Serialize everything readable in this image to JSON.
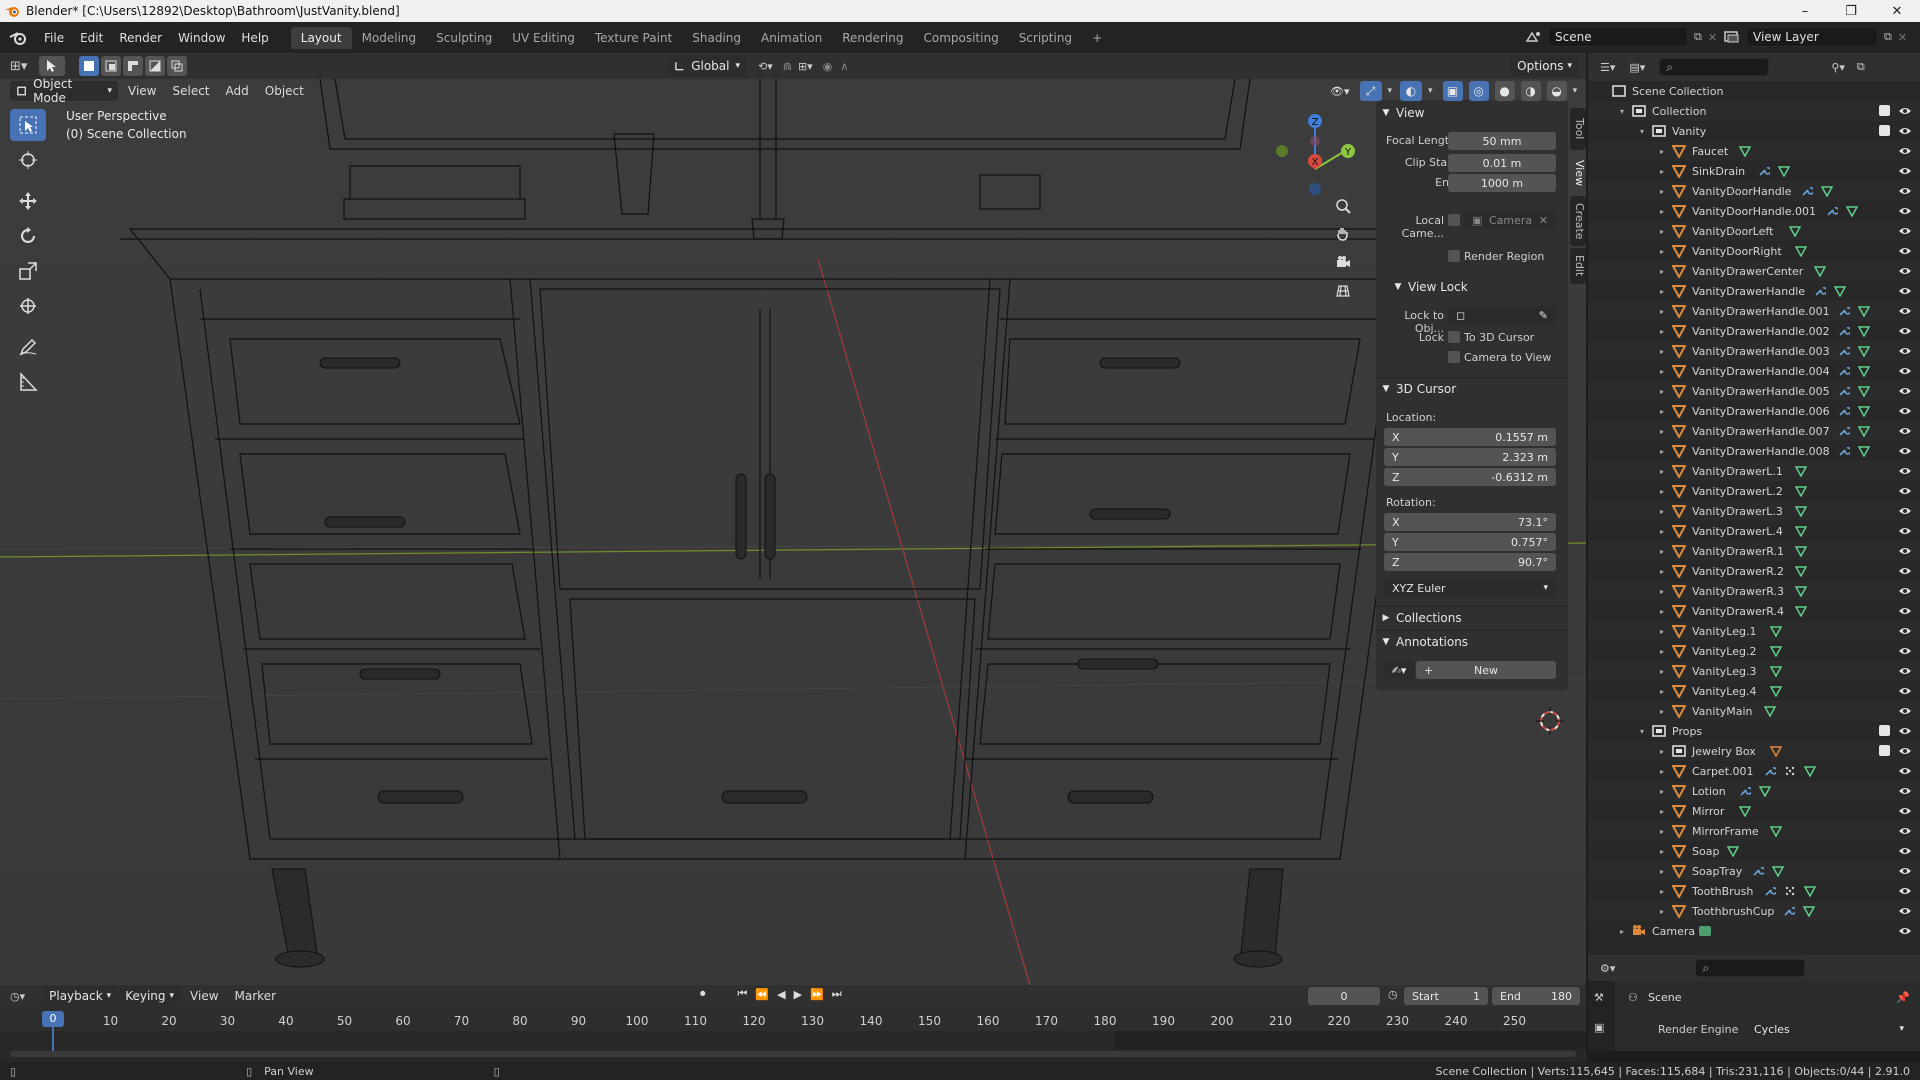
{
  "window": {
    "title": "Blender* [C:\\Users\\12892\\Desktop\\Bathroom\\JustVanity.blend]",
    "controls": [
      "–",
      "❐",
      "✕"
    ]
  },
  "topbar": {
    "menus": [
      "File",
      "Edit",
      "Render",
      "Window",
      "Help"
    ],
    "workspaces": [
      "Layout",
      "Modeling",
      "Sculpting",
      "UV Editing",
      "Texture Paint",
      "Shading",
      "Animation",
      "Rendering",
      "Compositing",
      "Scripting"
    ],
    "active_workspace": "Layout",
    "add_tab": "+",
    "scene": "Scene",
    "view_layer": "View Layer"
  },
  "tool_header": {
    "orientation": "Global",
    "options": "Options"
  },
  "viewport_header": {
    "mode": "Object Mode",
    "menus": [
      "View",
      "Select",
      "Add",
      "Object"
    ]
  },
  "viewport": {
    "perspective": "User Perspective",
    "collection": "(0) Scene Collection",
    "gizmo_axes": {
      "x": "X",
      "y": "Y",
      "z": "Z"
    }
  },
  "npanel": {
    "tabs": [
      "Tool",
      "View",
      "Create",
      "Edit"
    ],
    "active_tab": "View",
    "view": {
      "title": "View",
      "focal_length_label": "Focal Length",
      "focal_length": "50 mm",
      "clip_start_label": "Clip Start",
      "clip_start": "0.01 m",
      "clip_end_label": "End",
      "clip_end": "1000 m",
      "local_camera_label": "Local Came...",
      "local_camera_value": "Camera",
      "render_region": "Render Region"
    },
    "view_lock": {
      "title": "View Lock",
      "lock_to_obj_label": "Lock to Obj...",
      "lock_label": "Lock",
      "to_3d_cursor": "To 3D Cursor",
      "camera_to_view": "Camera to View"
    },
    "cursor": {
      "title": "3D Cursor",
      "location_label": "Location:",
      "loc_x": "0.1557 m",
      "loc_y": "2.323 m",
      "loc_z": "-0.6312 m",
      "rotation_label": "Rotation:",
      "rot_x": "73.1°",
      "rot_y": "0.757°",
      "rot_z": "90.7°",
      "rotation_mode": "XYZ Euler",
      "axis_x": "X",
      "axis_y": "Y",
      "axis_z": "Z"
    },
    "collections": "Collections",
    "annotations": "Annotations",
    "annotation_new": "New"
  },
  "outliner": {
    "rows": [
      {
        "name": "Scene Collection",
        "indent": 0,
        "type": "scene",
        "expand": ""
      },
      {
        "name": "Collection",
        "indent": 1,
        "type": "collection",
        "expand": "▾",
        "cb": true
      },
      {
        "name": "Vanity",
        "indent": 2,
        "type": "collection",
        "expand": "▾",
        "cb": true
      },
      {
        "name": "Faucet",
        "indent": 3,
        "type": "mesh",
        "expand": "▸",
        "mods": [
          "mesh"
        ]
      },
      {
        "name": "SinkDrain",
        "indent": 3,
        "type": "mesh",
        "expand": "▸",
        "mods": [
          "wrench",
          "mesh"
        ]
      },
      {
        "name": "VanityDoorHandle",
        "indent": 3,
        "type": "mesh",
        "expand": "▸",
        "mods": [
          "wrench",
          "mesh"
        ]
      },
      {
        "name": "VanityDoorHandle.001",
        "indent": 3,
        "type": "mesh",
        "expand": "▸",
        "mods": [
          "wrench",
          "mesh"
        ]
      },
      {
        "name": "VanityDoorLeft",
        "indent": 3,
        "type": "mesh",
        "expand": "▸",
        "mods": [
          "mesh"
        ]
      },
      {
        "name": "VanityDoorRight",
        "indent": 3,
        "type": "mesh",
        "expand": "▸",
        "mods": [
          "mesh"
        ]
      },
      {
        "name": "VanityDrawerCenter",
        "indent": 3,
        "type": "mesh",
        "expand": "▸",
        "mods": [
          "mesh"
        ]
      },
      {
        "name": "VanityDrawerHandle",
        "indent": 3,
        "type": "mesh",
        "expand": "▸",
        "mods": [
          "wrench",
          "mesh"
        ]
      },
      {
        "name": "VanityDrawerHandle.001",
        "indent": 3,
        "type": "mesh",
        "expand": "▸",
        "mods": [
          "wrench",
          "mesh"
        ]
      },
      {
        "name": "VanityDrawerHandle.002",
        "indent": 3,
        "type": "mesh",
        "expand": "▸",
        "mods": [
          "wrench",
          "mesh"
        ]
      },
      {
        "name": "VanityDrawerHandle.003",
        "indent": 3,
        "type": "mesh",
        "expand": "▸",
        "mods": [
          "wrench",
          "mesh"
        ]
      },
      {
        "name": "VanityDrawerHandle.004",
        "indent": 3,
        "type": "mesh",
        "expand": "▸",
        "mods": [
          "wrench",
          "mesh"
        ]
      },
      {
        "name": "VanityDrawerHandle.005",
        "indent": 3,
        "type": "mesh",
        "expand": "▸",
        "mods": [
          "wrench",
          "mesh"
        ]
      },
      {
        "name": "VanityDrawerHandle.006",
        "indent": 3,
        "type": "mesh",
        "expand": "▸",
        "mods": [
          "wrench",
          "mesh"
        ]
      },
      {
        "name": "VanityDrawerHandle.007",
        "indent": 3,
        "type": "mesh",
        "expand": "▸",
        "mods": [
          "wrench",
          "mesh"
        ]
      },
      {
        "name": "VanityDrawerHandle.008",
        "indent": 3,
        "type": "mesh",
        "expand": "▸",
        "mods": [
          "wrench",
          "mesh"
        ]
      },
      {
        "name": "VanityDrawerL.1",
        "indent": 3,
        "type": "mesh",
        "expand": "▸",
        "mods": [
          "mesh"
        ]
      },
      {
        "name": "VanityDrawerL.2",
        "indent": 3,
        "type": "mesh",
        "expand": "▸",
        "mods": [
          "mesh"
        ]
      },
      {
        "name": "VanityDrawerL.3",
        "indent": 3,
        "type": "mesh",
        "expand": "▸",
        "mods": [
          "mesh"
        ]
      },
      {
        "name": "VanityDrawerL.4",
        "indent": 3,
        "type": "mesh",
        "expand": "▸",
        "mods": [
          "mesh"
        ]
      },
      {
        "name": "VanityDrawerR.1",
        "indent": 3,
        "type": "mesh",
        "expand": "▸",
        "mods": [
          "mesh"
        ]
      },
      {
        "name": "VanityDrawerR.2",
        "indent": 3,
        "type": "mesh",
        "expand": "▸",
        "mods": [
          "mesh"
        ]
      },
      {
        "name": "VanityDrawerR.3",
        "indent": 3,
        "type": "mesh",
        "expand": "▸",
        "mods": [
          "mesh"
        ]
      },
      {
        "name": "VanityDrawerR.4",
        "indent": 3,
        "type": "mesh",
        "expand": "▸",
        "mods": [
          "mesh"
        ]
      },
      {
        "name": "VanityLeg.1",
        "indent": 3,
        "type": "mesh",
        "expand": "▸",
        "mods": [
          "mesh"
        ]
      },
      {
        "name": "VanityLeg.2",
        "indent": 3,
        "type": "mesh",
        "expand": "▸",
        "mods": [
          "mesh"
        ]
      },
      {
        "name": "VanityLeg.3",
        "indent": 3,
        "type": "mesh",
        "expand": "▸",
        "mods": [
          "mesh"
        ]
      },
      {
        "name": "VanityLeg.4",
        "indent": 3,
        "type": "mesh",
        "expand": "▸",
        "mods": [
          "mesh"
        ]
      },
      {
        "name": "VanityMain",
        "indent": 3,
        "type": "mesh",
        "expand": "▸",
        "mods": [
          "mesh"
        ]
      },
      {
        "name": "Props",
        "indent": 2,
        "type": "collection",
        "expand": "▾",
        "cb": true
      },
      {
        "name": "Jewelry Box",
        "indent": 3,
        "type": "collection",
        "expand": "▸",
        "mods": [
          "mesh6"
        ],
        "cb": true
      },
      {
        "name": "Carpet.001",
        "indent": 3,
        "type": "mesh",
        "expand": "▸",
        "mods": [
          "wrench",
          "grid",
          "mesh"
        ]
      },
      {
        "name": "Lotion",
        "indent": 3,
        "type": "mesh",
        "expand": "▸",
        "mods": [
          "wrench",
          "mesh"
        ]
      },
      {
        "name": "Mirror",
        "indent": 3,
        "type": "mesh",
        "expand": "▸",
        "mods": [
          "mesh"
        ]
      },
      {
        "name": "MirrorFrame",
        "indent": 3,
        "type": "mesh",
        "expand": "▸",
        "mods": [
          "mesh"
        ]
      },
      {
        "name": "Soap",
        "indent": 3,
        "type": "mesh",
        "expand": "▸",
        "mods": [
          "mesh"
        ]
      },
      {
        "name": "SoapTray",
        "indent": 3,
        "type": "mesh",
        "expand": "▸",
        "mods": [
          "wrench",
          "mesh"
        ]
      },
      {
        "name": "ToothBrush",
        "indent": 3,
        "type": "mesh",
        "expand": "▸",
        "mods": [
          "wrench",
          "grid",
          "mesh"
        ]
      },
      {
        "name": "ToothbrushCup",
        "indent": 3,
        "type": "mesh",
        "expand": "▸",
        "mods": [
          "wrench",
          "mesh"
        ]
      },
      {
        "name": "Camera",
        "indent": 1,
        "type": "camera",
        "expand": "▸",
        "mods": [
          "cam"
        ]
      }
    ]
  },
  "properties": {
    "scene_label": "Scene",
    "render_engine_label": "Render Engine",
    "render_engine": "Cycles"
  },
  "timeline": {
    "menus": [
      "Playback",
      "Keying",
      "View",
      "Marker"
    ],
    "current_frame": "0",
    "start_label": "Start",
    "start": "1",
    "end_label": "End",
    "end": "180",
    "ticks": [
      "0",
      "10",
      "20",
      "30",
      "40",
      "50",
      "60",
      "70",
      "80",
      "90",
      "100",
      "110",
      "120",
      "130",
      "140",
      "150",
      "160",
      "170",
      "180",
      "190",
      "200",
      "210",
      "220",
      "230",
      "240",
      "250"
    ]
  },
  "statusbar": {
    "hint": "Pan View",
    "stats": "Scene Collection | Verts:115,645 | Faces:115,684 | Tris:231,116 | Objects:0/44 | 2.91.0"
  },
  "colors": {
    "accent": "#4772b3",
    "mesh_icon": "#e08a3c",
    "modifier_icon": "#6aa2d9",
    "data_icon": "#5fd08a",
    "axis_x": "#d9473f",
    "axis_y": "#8cc63f",
    "axis_z": "#3f7fd9"
  }
}
